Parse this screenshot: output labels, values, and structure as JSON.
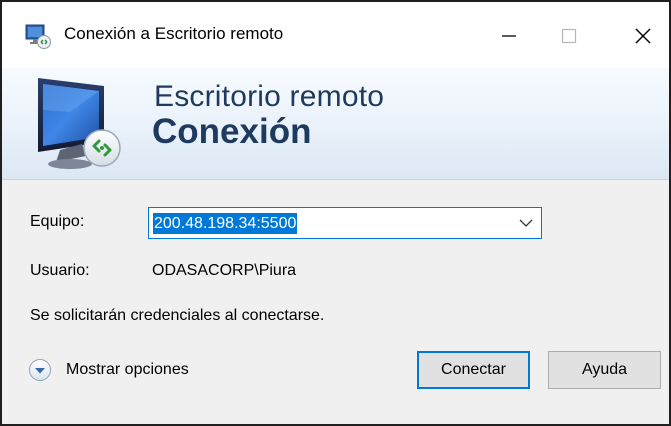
{
  "window": {
    "title": "Conexión a Escritorio remoto",
    "controls": {
      "minimize_icon": "minimize-icon",
      "maximize_icon": "maximize-icon",
      "close_icon": "close-icon"
    }
  },
  "banner": {
    "line1": "Escritorio remoto",
    "line2": "Conexión",
    "icon": "remote-desktop-monitor-icon"
  },
  "form": {
    "computer_label": "Equipo:",
    "computer_value": "200.48.198.34:5500",
    "user_label": "Usuario:",
    "user_value": "ODASACORP\\Piura",
    "credentials_note": "Se solicitarán credenciales al conectarse."
  },
  "footer": {
    "show_options_label": "Mostrar opciones",
    "connect_label": "Conectar",
    "help_label": "Ayuda"
  },
  "colors": {
    "accent": "#0078d7",
    "banner_text": "#1e3a5e",
    "dialog_background": "#f0f0f0",
    "button_background": "#e1e1e1"
  }
}
